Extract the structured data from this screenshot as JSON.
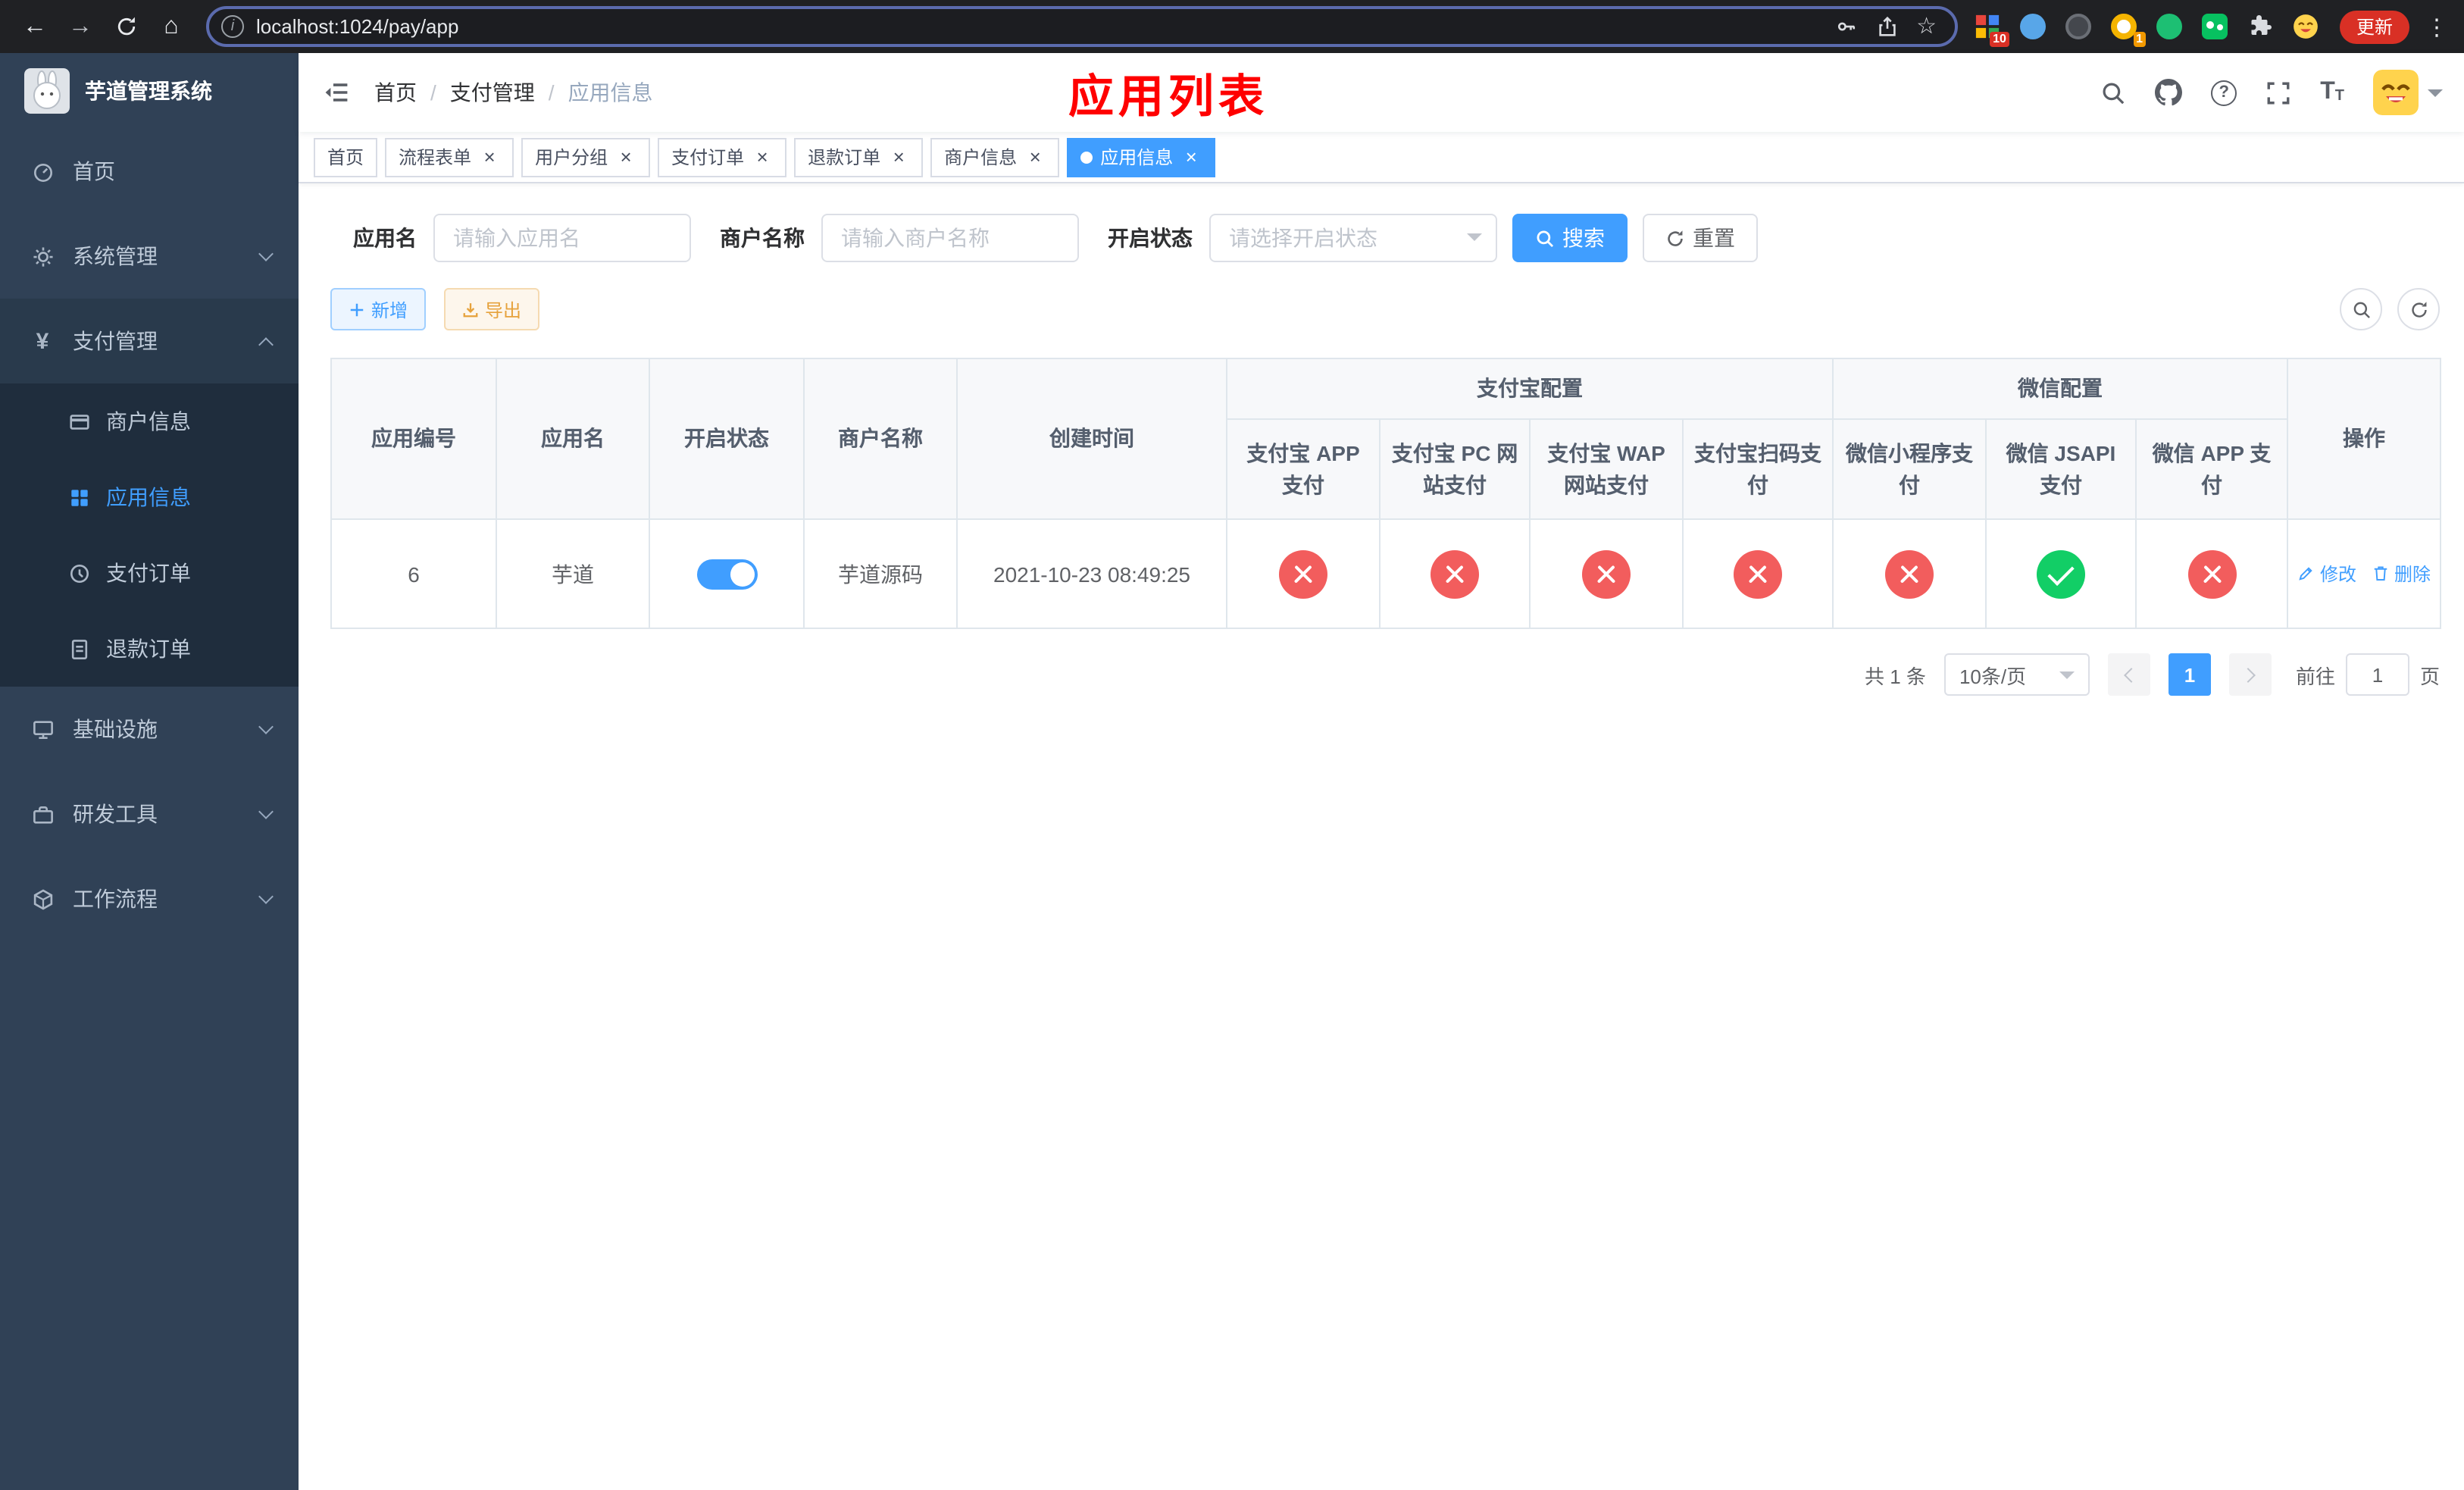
{
  "colors": {
    "accent": "#409eff",
    "page_title_red": "#ff0000",
    "status_off_red": "#f25d5d",
    "status_on_green": "#12ce66",
    "warning": "#e6a23c",
    "sidebar_bg": "#304156",
    "sidebar_submenu_bg": "#1f2d3d"
  },
  "browser": {
    "url": "localhost:1024/pay/app",
    "update_button": "更新",
    "badge_grid": "10",
    "badge_ring": "1"
  },
  "sidebar": {
    "title": "芋道管理系统",
    "items": [
      {
        "label": "首页"
      },
      {
        "label": "系统管理"
      },
      {
        "label": "支付管理",
        "children": [
          {
            "label": "商户信息"
          },
          {
            "label": "应用信息"
          },
          {
            "label": "支付订单"
          },
          {
            "label": "退款订单"
          }
        ]
      },
      {
        "label": "基础设施"
      },
      {
        "label": "研发工具"
      },
      {
        "label": "工作流程"
      }
    ]
  },
  "navbar": {
    "breadcrumb": [
      {
        "label": "首页"
      },
      {
        "label": "支付管理"
      },
      {
        "label": "应用信息"
      }
    ],
    "separator": "/",
    "page_title": "应用列表"
  },
  "tabs": [
    {
      "label": "首页"
    },
    {
      "label": "流程表单"
    },
    {
      "label": "用户分组"
    },
    {
      "label": "支付订单"
    },
    {
      "label": "退款订单"
    },
    {
      "label": "商户信息"
    },
    {
      "label": "应用信息"
    }
  ],
  "filters": {
    "app_name_label": "应用名",
    "app_name_placeholder": "请输入应用名",
    "merchant_label": "商户名称",
    "merchant_placeholder": "请输入商户名称",
    "status_label": "开启状态",
    "status_placeholder": "请选择开启状态",
    "search_button": "搜索",
    "reset_button": "重置"
  },
  "toolbar": {
    "add_button": "新增",
    "export_button": "导出"
  },
  "table": {
    "headers": {
      "app_id": "应用编号",
      "app_name": "应用名",
      "status": "开启状态",
      "merchant_name": "商户名称",
      "create_time": "创建时间",
      "alipay_group": "支付宝配置",
      "wechat_group": "微信配置",
      "alipay_app": "支付宝 APP 支付",
      "alipay_pc": "支付宝 PC 网站支付",
      "alipay_wap": "支付宝 WAP 网站支付",
      "alipay_scan": "支付宝扫码支付",
      "wechat_lite": "微信小程序支付",
      "wechat_jsapi": "微信 JSAPI 支付",
      "wechat_app": "微信 APP 支付",
      "actions": "操作"
    },
    "rows": [
      {
        "app_id": "6",
        "app_name": "芋道",
        "status_enabled": true,
        "merchant_name": "芋道源码",
        "create_time": "2021-10-23 08:49:25",
        "alipay_app": false,
        "alipay_pc": false,
        "alipay_wap": false,
        "alipay_scan": false,
        "wechat_lite": false,
        "wechat_jsapi": true,
        "wechat_app": false,
        "edit_label": "修改",
        "delete_label": "删除"
      }
    ]
  },
  "pagination": {
    "total_text": "共 1 条",
    "page_size": "10条/页",
    "current_page": "1",
    "goto_prefix": "前往",
    "goto_value": "1",
    "goto_suffix": "页"
  },
  "icons": {
    "back": "←",
    "forward": "→",
    "home": "⌂",
    "info": "i",
    "star": "☆",
    "kebab": "⋮",
    "question": "?",
    "yen": "¥",
    "close": "×",
    "font_large": "T",
    "font_small": "T"
  }
}
